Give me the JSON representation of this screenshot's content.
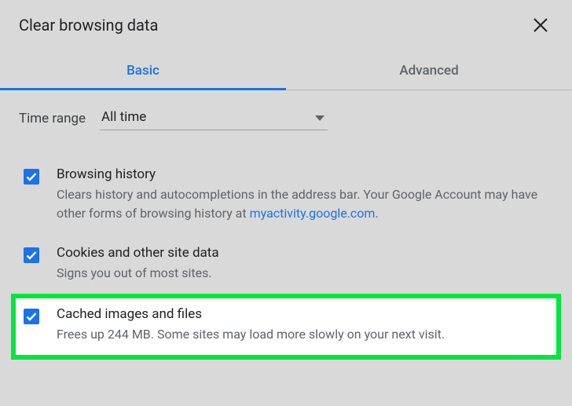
{
  "dialog": {
    "title": "Clear browsing data"
  },
  "tabs": {
    "basic": "Basic",
    "advanced": "Advanced"
  },
  "timeRange": {
    "label": "Time range",
    "value": "All time"
  },
  "options": {
    "browsingHistory": {
      "title": "Browsing history",
      "descPrefix": "Clears history and autocompletions in the address bar. Your Google Account may have other forms of browsing history at ",
      "link": "myactivity.google.com",
      "descSuffix": "."
    },
    "cookies": {
      "title": "Cookies and other site data",
      "desc": "Signs you out of most sites."
    },
    "cached": {
      "title": "Cached images and files",
      "desc": "Frees up 244 MB. Some sites may load more slowly on your next visit."
    }
  }
}
